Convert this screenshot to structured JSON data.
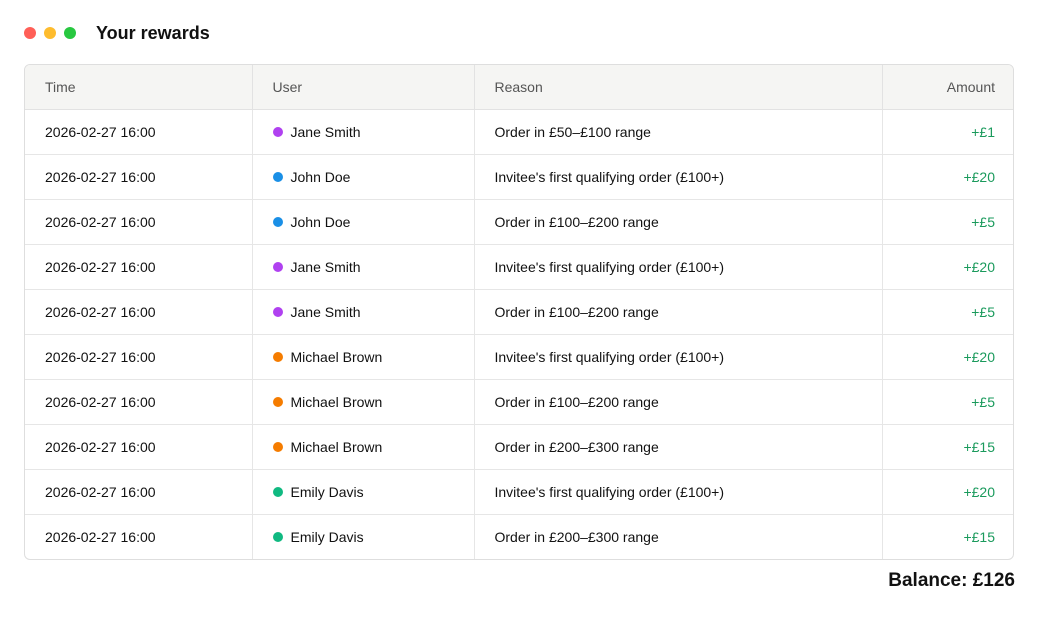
{
  "window": {
    "title": "Your rewards",
    "controls": [
      "close",
      "minimize",
      "maximize"
    ]
  },
  "colors": {
    "amount_positive": "#1a9a5c",
    "users": {
      "Jane Smith": "#b041f0",
      "John Doe": "#1a8fe6",
      "Michael Brown": "#f57c00",
      "Emily Davis": "#10b981"
    }
  },
  "table": {
    "columns": {
      "time": "Time",
      "user": "User",
      "reason": "Reason",
      "amount": "Amount"
    },
    "rows": [
      {
        "time": "2026-02-27 16:00",
        "user": "Jane Smith",
        "user_color": "#b041f0",
        "reason": "Order in £50–£100 range",
        "amount": "+£1"
      },
      {
        "time": "2026-02-27 16:00",
        "user": "John Doe",
        "user_color": "#1a8fe6",
        "reason": "Invitee's first qualifying order (£100+)",
        "amount": "+£20"
      },
      {
        "time": "2026-02-27 16:00",
        "user": "John Doe",
        "user_color": "#1a8fe6",
        "reason": "Order in £100–£200 range",
        "amount": "+£5"
      },
      {
        "time": "2026-02-27 16:00",
        "user": "Jane Smith",
        "user_color": "#b041f0",
        "reason": "Invitee's first qualifying order (£100+)",
        "amount": "+£20"
      },
      {
        "time": "2026-02-27 16:00",
        "user": "Jane Smith",
        "user_color": "#b041f0",
        "reason": "Order in £100–£200 range",
        "amount": "+£5"
      },
      {
        "time": "2026-02-27 16:00",
        "user": "Michael Brown",
        "user_color": "#f57c00",
        "reason": "Invitee's first qualifying order (£100+)",
        "amount": "+£20"
      },
      {
        "time": "2026-02-27 16:00",
        "user": "Michael Brown",
        "user_color": "#f57c00",
        "reason": "Order in £100–£200 range",
        "amount": "+£5"
      },
      {
        "time": "2026-02-27 16:00",
        "user": "Michael Brown",
        "user_color": "#f57c00",
        "reason": "Order in £200–£300 range",
        "amount": "+£15"
      },
      {
        "time": "2026-02-27 16:00",
        "user": "Emily Davis",
        "user_color": "#10b981",
        "reason": "Invitee's first qualifying order (£100+)",
        "amount": "+£20"
      },
      {
        "time": "2026-02-27 16:00",
        "user": "Emily Davis",
        "user_color": "#10b981",
        "reason": "Order in £200–£300 range",
        "amount": "+£15"
      }
    ]
  },
  "balance": {
    "label": "Balance: £126"
  }
}
